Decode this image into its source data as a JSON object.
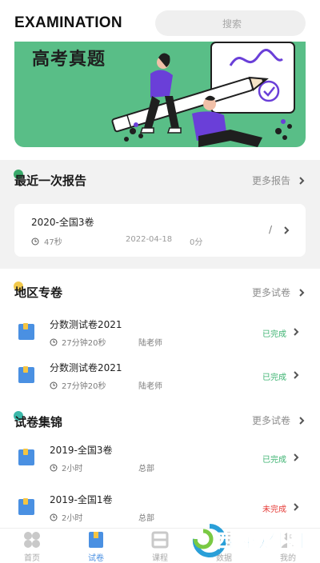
{
  "header": {
    "app_title": "EXAMINATION",
    "search_placeholder": "搜索"
  },
  "banner": {
    "title": "高考真题"
  },
  "recent_report": {
    "section_title": "最近一次报告",
    "more_label": "更多报告",
    "card": {
      "name": "2020-全国3卷",
      "duration": "47秒",
      "date": "2022-04-18",
      "score": "0分",
      "slash": "/"
    }
  },
  "region": {
    "section_title": "地区专卷",
    "more_label": "更多试卷",
    "items": [
      {
        "title": "分数测试卷2021",
        "duration": "27分钟20秒",
        "teacher": "陆老师",
        "status": "已完成"
      },
      {
        "title": "分数测试卷2021",
        "duration": "27分钟20秒",
        "teacher": "陆老师",
        "status": "已完成"
      }
    ]
  },
  "collection": {
    "section_title": "试卷集锦",
    "more_label": "更多试卷",
    "items": [
      {
        "title": "2019-全国3卷",
        "duration": "2小时",
        "teacher": "总部",
        "status": "已完成"
      },
      {
        "title": "2019-全国1卷",
        "duration": "2小时",
        "teacher": "总部",
        "status": "未完成"
      }
    ]
  },
  "bottom_nav": {
    "items": [
      {
        "label": "首页",
        "icon": "home-icon"
      },
      {
        "label": "试卷",
        "icon": "paper-icon"
      },
      {
        "label": "课程",
        "icon": "course-icon"
      },
      {
        "label": "数据",
        "icon": "data-icon"
      },
      {
        "label": "我的",
        "icon": "profile-icon"
      }
    ],
    "active_index": 1
  },
  "watermark": {
    "text": "西西软件园"
  },
  "colors": {
    "banner_green": "#59be87",
    "accent_blue": "#4a90e2",
    "done_green": "#3cb371",
    "undone_red": "#e53935",
    "report_dot": "#3aaa6b",
    "region_dot": "#f2c94c",
    "collection_dot": "#3bb8a9"
  }
}
